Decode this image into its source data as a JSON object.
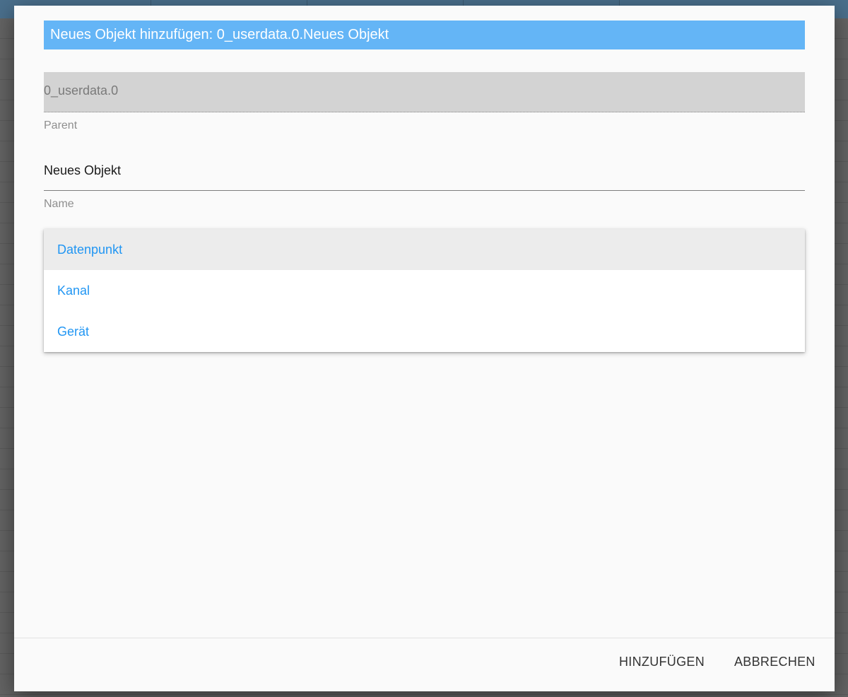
{
  "dialog": {
    "title": "Neues Objekt hinzufügen: 0_userdata.0.Neues Objekt",
    "parent": {
      "value": "0_userdata.0",
      "helper": "Parent"
    },
    "name": {
      "value": "Neues Objekt",
      "helper": "Name"
    },
    "type_menu": {
      "selected": "Datenpunkt",
      "options": [
        "Datenpunkt",
        "Kanal",
        "Gerät"
      ]
    },
    "actions": {
      "add_label": "HINZUFÜGEN",
      "cancel_label": "ABBRECHEN"
    }
  },
  "colors": {
    "title_bg": "#64b5f6",
    "accent": "#2196f3",
    "dialog_bg": "#fafafa"
  }
}
